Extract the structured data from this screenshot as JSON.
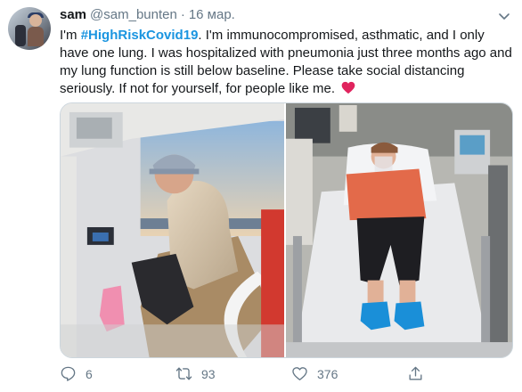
{
  "author": {
    "name": "sam",
    "handle": "@sam_bunten",
    "separator": "·",
    "date": "16 мар."
  },
  "tweet": {
    "text_before": "I'm ",
    "hashtag": "#HighRiskCovid19",
    "text_after": ". I'm immunocompromised, asthmatic, and I only have one lung. I was hospitalized with pneumonia just three months ago and my lung function is still below baseline. Please take social distancing seriously. If not for yourself, for people like me. ",
    "emoji": "heart-icon"
  },
  "actions": {
    "replies": "6",
    "retweets": "93",
    "likes": "376"
  },
  "colors": {
    "link": "#1b95e0",
    "muted": "#657786",
    "border": "#ccd6dd",
    "heart": "#e0245e"
  }
}
